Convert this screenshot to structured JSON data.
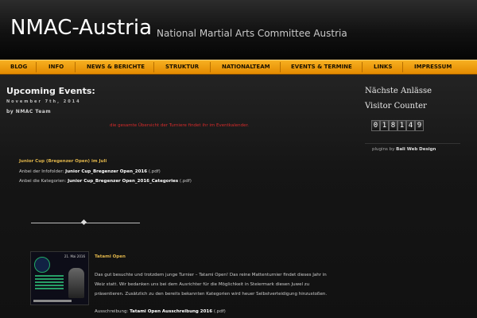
{
  "header": {
    "title": "NMAC-Austria",
    "subtitle": "National Martial Arts Committee Austria"
  },
  "nav": {
    "items": [
      "BLOG",
      "INFO",
      "NEWS & BERICHTE",
      "STRUKTUR",
      "NATIONALTEAM",
      "EVENTS & TERMINE",
      "LINKS",
      "IMPRESSUM"
    ]
  },
  "post": {
    "title": "Upcoming Events:",
    "date": "November 7th, 2014",
    "author": "by NMAC Team",
    "red_note": "die gesamte Übersicht der Turniere findet ihr im Eventkalender.",
    "junior": {
      "heading": "Junior Cup (Bregenzer Open) im Juli",
      "line1_prefix": "Anbei der Infofolder:",
      "line1_link": "Junior Cup_Bregenzer Open_2016",
      "line1_suffix": "(.pdf)",
      "line2_prefix": "Anbei die Kategorien:",
      "line2_link": "Junior Cup_Bregenzer Open_2016_Categories",
      "line2_suffix": "(.pdf)"
    },
    "tatami": {
      "heading": "Tatami Open",
      "para_line1": "Das gut besuchte und trotzdem junge Turnier – Tatami Open! Das reine Mattenturnier findet dieses Jahr in",
      "para_line2": "Weiz statt. Wir bedanken uns bei dem Ausrichter für die Möglichkeit in Steiermark diesen Juwel zu",
      "para_line3": "präsentieren. Zusätzlich zu den bereits bekannten Kategorien wird heuer Selbstverteidigung hinzustoßen.",
      "ausschreibung_prefix": "Ausschreibung:",
      "ausschreibung_link": "Tatami Open Ausschreibung 2016",
      "ausschreibung_suffix": "(.pdf)",
      "poster_date": "21. Mai 2016"
    }
  },
  "sidebar": {
    "next_events_title": "Nächste Anlässe",
    "visitor_counter_title": "Visitor Counter",
    "counter_digits": [
      "0",
      "1",
      "8",
      "1",
      "4",
      "9"
    ],
    "plugins_prefix": "plugins by",
    "plugins_link": "Bali Web Design"
  }
}
